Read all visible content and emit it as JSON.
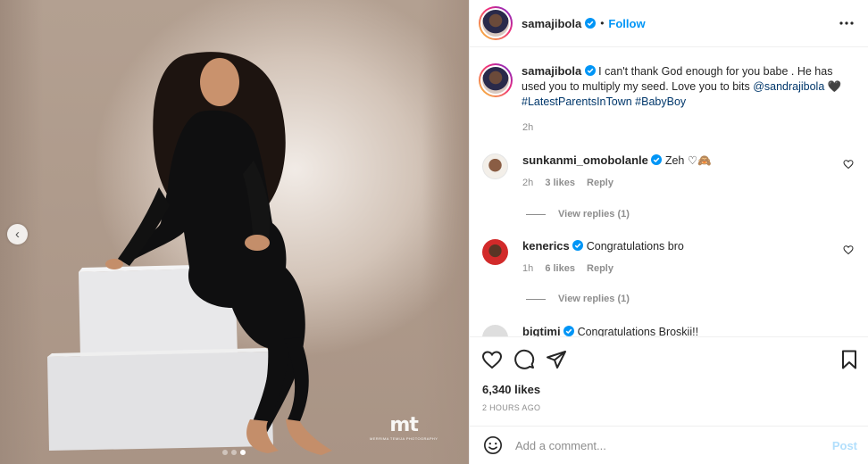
{
  "post": {
    "username": "samajibola",
    "follow_label": "Follow",
    "separator": "•"
  },
  "caption": {
    "username": "samajibola",
    "text": "I can't thank God enough for you babe . He has used you to multiply my seed. Love you to bits",
    "mention": "@sandrajibola",
    "heart": "🖤",
    "hashtags": "#LatestParentsInTown #BabyBoy",
    "time": "2h"
  },
  "comments": [
    {
      "username": "sunkanmi_omobolanle",
      "text": "Zeh ♡🙈",
      "time": "2h",
      "likes": "3 likes",
      "reply": "Reply",
      "view_replies": "View replies (1)"
    },
    {
      "username": "kenerics",
      "text": "Congratulations bro",
      "time": "1h",
      "likes": "6 likes",
      "reply": "Reply",
      "view_replies": "View replies (1)"
    },
    {
      "username": "bigtimi",
      "text": "Congratulations Broskii!!"
    }
  ],
  "stats": {
    "likes": "6,340 likes",
    "time": "2 HOURS AGO"
  },
  "comment_box": {
    "placeholder": "Add a comment...",
    "post_label": "Post"
  },
  "carousel": {
    "count": 3,
    "active_index": 2
  },
  "watermark": {
    "mark": "mt",
    "sub": "MERRIMA TEMIJA PHOTOGRAPHY"
  },
  "colors": {
    "accent": "#0095f6",
    "post_disabled": "#b2dffc",
    "secondary_text": "#8e8e8e"
  }
}
